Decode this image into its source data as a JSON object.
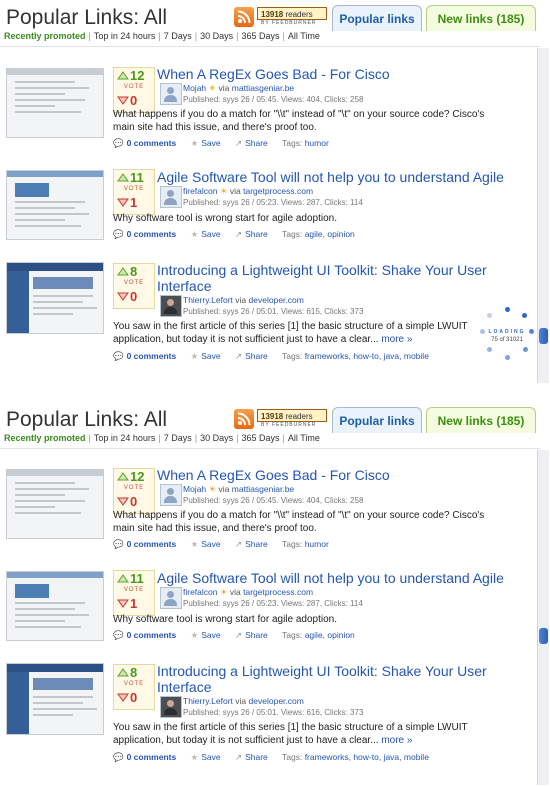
{
  "header": {
    "title": "Popular Links: All",
    "feedburner_count": "13918",
    "feedburner_unit": "readers",
    "feedburner_by": "BY FEEDBURNER",
    "tab_popular": "Popular links",
    "tab_new": "New links (185)"
  },
  "filters": [
    "Recently promoted",
    "Top in 24 hours",
    "7 Days",
    "30 Days",
    "365 Days",
    "All Time"
  ],
  "loading": {
    "label": "LOADING",
    "progress": "75 of 31021"
  },
  "panels": [
    {
      "items": [
        {
          "up": "12",
          "vote_label": "VOTE",
          "down": "0",
          "title": "When A RegEx Goes Bad - For Cisco",
          "user": "Mojah",
          "via": "via",
          "site": "mattiasgeniar.be",
          "meta": "Published: syys 26 / 05:45. Views: 404, Clicks: 258",
          "desc": "What happens if you do a match for \"\\\\t\" instead of \"\\t\" on your source code? Cisco's main site had this issue, and there's proof too.",
          "more": "",
          "comments": "0 comments",
          "save": "Save",
          "share": "Share",
          "tags_label": "Tags:",
          "tags": "humor"
        },
        {
          "up": "11",
          "vote_label": "VOTE",
          "down": "1",
          "title": "Agile Software Tool will not help you to understand Agile",
          "user": "firefalcon",
          "via": "via",
          "site": "targetprocess.com",
          "meta": "Published: syys 26 / 05:23. Views: 287, Clicks: 114",
          "desc": "Why software tool is wrong start for agile adoption.",
          "more": "",
          "comments": "0 comments",
          "save": "Save",
          "share": "Share",
          "tags_label": "Tags:",
          "tags": "agile, opinion"
        },
        {
          "up": "8",
          "vote_label": "VOTE",
          "down": "0",
          "title": "Introducing a Lightweight UI Toolkit: Shake Your User Interface",
          "user": "Thierry.Lefort",
          "via": "via",
          "site": "developer.com",
          "meta": "Published: syys 26 / 05:01. Views: 615, Clicks: 373",
          "desc": "You saw in the first article of this series [1] the basic structure of a simple LWUIT application, but today it is not sufficient just to have a clear...",
          "more": "more »",
          "comments": "0 comments",
          "save": "Save",
          "share": "Share",
          "tags_label": "Tags:",
          "tags": "frameworks, how-to, java, mobile"
        }
      ]
    },
    {
      "items": [
        {
          "up": "12",
          "vote_label": "VOTE",
          "down": "0",
          "title": "When A RegEx Goes Bad - For Cisco",
          "user": "Mojah",
          "via": "via",
          "site": "mattiasgeniar.be",
          "meta": "Published: syys 26 / 05:45. Views: 404, Clicks: 258",
          "desc": "What happens if you do a match for \"\\\\t\" instead of \"\\t\" on your source code? Cisco's main site had this issue, and there's proof too.",
          "more": "",
          "comments": "0 comments",
          "save": "Save",
          "share": "Share",
          "tags_label": "Tags:",
          "tags": "humor"
        },
        {
          "up": "11",
          "vote_label": "VOTE",
          "down": "1",
          "title": "Agile Software Tool will not help you to understand Agile",
          "user": "firefalcon",
          "via": "via",
          "site": "targetprocess.com",
          "meta": "Published: syys 26 / 05:23. Views: 287, Clicks: 114",
          "desc": "Why software tool is wrong start for agile adoption.",
          "more": "",
          "comments": "0 comments",
          "save": "Save",
          "share": "Share",
          "tags_label": "Tags:",
          "tags": "agile, opinion"
        },
        {
          "up": "8",
          "vote_label": "VOTE",
          "down": "0",
          "title": "Introducing a Lightweight UI Toolkit: Shake Your User Interface",
          "user": "Thierry.Lefort",
          "via": "via",
          "site": "developer.com",
          "meta": "Published: syys 26 / 05:01. Views: 616, Clicks: 373",
          "desc": "You saw in the first article of this series [1] the basic structure of a simple LWUIT application, but today it is not sufficient just to have a clear...",
          "more": "more »",
          "comments": "0 comments",
          "save": "Save",
          "share": "Share",
          "tags_label": "Tags:",
          "tags": "frameworks, how-to, java, mobile"
        }
      ]
    }
  ]
}
